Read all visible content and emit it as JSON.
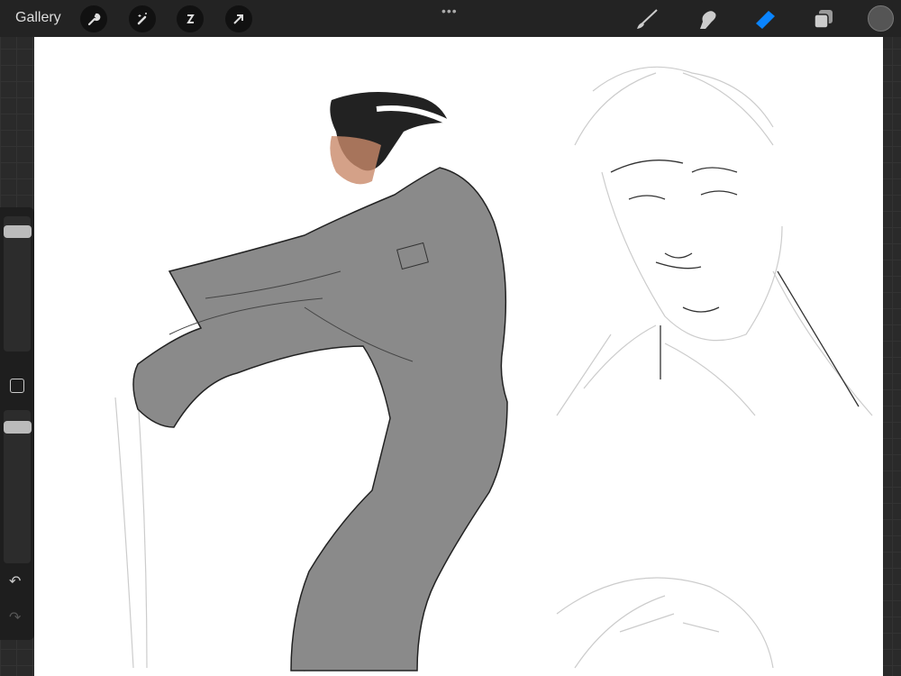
{
  "toolbar": {
    "gallery_label": "Gallery",
    "more_icon": "•••",
    "left_tools": [
      "wrench-icon",
      "magic-wand-icon",
      "selection-icon",
      "transform-arrow-icon"
    ],
    "right_tools": [
      "brush-icon",
      "smudge-icon",
      "eraser-icon",
      "layers-icon"
    ],
    "active_tool": "eraser",
    "active_color": "#0a84ff",
    "current_color": "#555555"
  },
  "sidebar": {
    "undo_icon": "↶",
    "redo_icon": "↷"
  }
}
